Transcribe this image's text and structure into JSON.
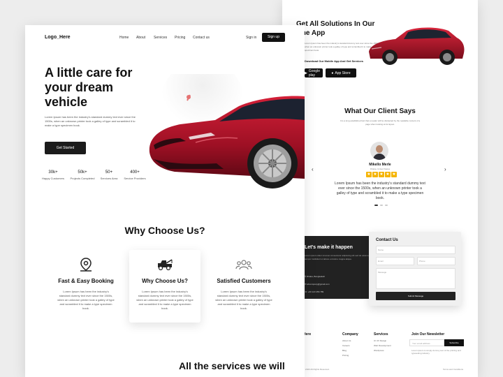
{
  "back": {
    "app": {
      "title": "Get All Solutions In Our One App",
      "text": "Lorem Ipsum has been the industry's standard dummy text ever since the 1500s, when an unknown printer took a galley of type and scrambled it to make a type specimen book.",
      "download_label": "Download Our Mobile App And Get Services",
      "google_play": "Google play",
      "app_store": "App Store"
    },
    "clients": {
      "title": "What Our Client Says",
      "subtitle": "It is a long established fact that a reader will be distracted by the readable content of a page when looking at its layout.",
      "name": "Mikello Merle",
      "role": "Dhaka, United States",
      "rating": 5,
      "review": "Lorem Ipsum has been the industry's standard dummy text ever since the 1500s, when an unknown printer took a galley of type and scrambled it to make a type specimen book."
    },
    "contact": {
      "dark_title": "Let's make it happen",
      "dark_text": "Lorem ipsum dolor sit amet consectetur adipiscing elit sed do eiusmod tempor incididunt ut labore et dolore magna aliqua.",
      "address": "Dhaka, Bangladesh",
      "email": "abcompany@gmail.com",
      "phone": "+00 123 456 789",
      "form_title": "Contact Us",
      "name_placeholder": "Name",
      "email_placeholder": "Email",
      "phone_placeholder": "Phone",
      "message_placeholder": "Message",
      "submit": "Submit Message"
    },
    "footer": {
      "logo": "Here",
      "company_title": "Company",
      "company_links": [
        "About Us",
        "Careers",
        "Blog",
        "Pricing"
      ],
      "services_title": "Services",
      "services_links": [
        "UI UX Design",
        "Web Development",
        "Wordpress"
      ],
      "newsletter_title": "Join Our Newsletter",
      "newsletter_placeholder": "Your email address",
      "subscribe": "Subscribe",
      "newsletter_note": "Lorem ipsum is simply dummy text of the printing and typesetting industry.",
      "copyright": "© 2023 All Rights Reserved.",
      "legal": "Terms and Conditions"
    }
  },
  "front": {
    "logo": "Logo_Here",
    "nav": [
      "Home",
      "About",
      "Services",
      "Pricing",
      "Contact us"
    ],
    "sign_in": "Sign in",
    "sign_up": "Sign up",
    "hero": {
      "title": "A little care for your dream vehicle",
      "text": "Lorem Ipsum has been the industry's standard dummy text ever since the 1500s, when an unknown printer took a galley of type and scrambled it to make a type specimen book.",
      "cta": "Get Started"
    },
    "stats": [
      {
        "value": "30k+",
        "label": "Happy Customers"
      },
      {
        "value": "50k+",
        "label": "Projects Completed"
      },
      {
        "value": "50+",
        "label": "Services Area"
      },
      {
        "value": "400+",
        "label": "Service Providers"
      }
    ],
    "why_title": "Why Choose Us?",
    "features": [
      {
        "icon": "location-pin-icon",
        "title": "Fast & Easy Booking",
        "text": "Lorem Ipsum has been the industry's standard dummy text ever since the 1500s, when an unknown printer took a galley of type and scrambled it to make a type specimen book."
      },
      {
        "icon": "tow-truck-icon",
        "title": "Why Choose Us?",
        "text": "Lorem Ipsum has been the industry's standard dummy text ever since the 1500s, when an unknown printer took a galley of type and scrambled it to make a type specimen book."
      },
      {
        "icon": "users-group-icon",
        "title": "Satisfied Customers",
        "text": "Lorem Ipsum has been the industry's standard dummy text ever since the 1500s, when an unknown printer took a galley of type and scrambled it to make a type specimen book."
      }
    ],
    "services_title": "All the services we will"
  },
  "colors": {
    "car": "#b0142a",
    "dark": "#1b1b1b",
    "star": "#f5b400"
  }
}
